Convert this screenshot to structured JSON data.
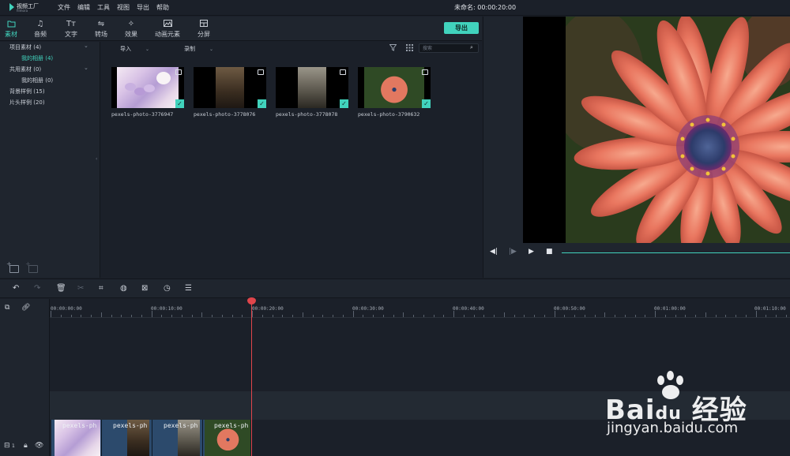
{
  "app": {
    "logo_name": "视频工厂",
    "logo_sub": "filmora",
    "menu": [
      "文件",
      "编辑",
      "工具",
      "视图",
      "导出",
      "帮助"
    ],
    "project_title": "未命名: 00:00:20:00"
  },
  "tabs": [
    {
      "label": "素材",
      "icon": "folder-icon",
      "active": true
    },
    {
      "label": "音频",
      "icon": "music-note-icon",
      "active": false
    },
    {
      "label": "文字",
      "icon": "text-icon",
      "active": false
    },
    {
      "label": "转场",
      "icon": "transition-icon",
      "active": false
    },
    {
      "label": "效果",
      "icon": "effects-icon",
      "active": false
    },
    {
      "label": "动画元素",
      "icon": "image-icon",
      "active": false
    },
    {
      "label": "分屏",
      "icon": "split-screen-icon",
      "active": false
    }
  ],
  "export_button": "导出",
  "library": {
    "items": [
      {
        "label": "项目素材 (4)",
        "level": 0,
        "expandable": true
      },
      {
        "label": "我的相册 (4)",
        "level": 1,
        "active": true
      },
      {
        "label": "共用素材 (0)",
        "level": 0,
        "expandable": true
      },
      {
        "label": "我的相册 (0)",
        "level": 1
      },
      {
        "label": "背景样例 (15)",
        "level": 0
      },
      {
        "label": "片头样例 (20)",
        "level": 0
      }
    ]
  },
  "media_bar": {
    "import_label": "导入",
    "record_label": "录制",
    "search_placeholder": "搜索"
  },
  "clips": [
    {
      "name": "pexels-photo-3776947"
    },
    {
      "name": "pexels-photo-3778076"
    },
    {
      "name": "pexels-photo-3778078"
    },
    {
      "name": "pexels-photo-3790632"
    }
  ],
  "timeline": {
    "ruler_labels": [
      "00:00:00:00",
      "00:00:10:00",
      "00:00:20:00",
      "00:00:30:00",
      "00:00:40:00",
      "00:00:50:00",
      "00:01:00:00",
      "00:01:10:00"
    ],
    "video_track_index": "1",
    "video_clips": [
      "pexels-ph",
      "pexels-ph",
      "pexels-ph",
      "pexels-ph"
    ]
  },
  "watermark": {
    "brand": "Bai",
    "brand_tail": "经验",
    "url": "jingyan.baidu.com"
  },
  "colors": {
    "accent": "#41d3bd",
    "playhead": "#e0454b",
    "background": "#1b2029"
  }
}
